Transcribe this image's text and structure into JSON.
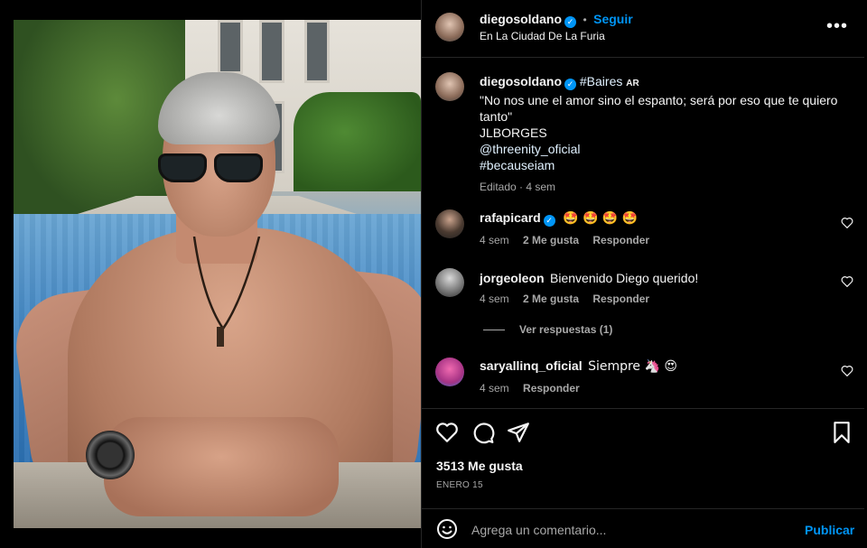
{
  "post": {
    "author": "diegosoldano",
    "follow_label": "Seguir",
    "location": "En La Ciudad De La Furia",
    "more_icon": "more-horizontal-icon"
  },
  "caption": {
    "author": "diegosoldano",
    "tag_inline": "#Baires",
    "country": "AR",
    "lines": [
      "\"No nos une el amor sino el espanto; será por eso que te quiero",
      "tanto\"",
      "JLBORGES",
      "@threenity_oficial",
      "#becauseiam"
    ],
    "meta": "Editado · 4 sem"
  },
  "comments": [
    {
      "user": "rafapicard",
      "verified": true,
      "text": "🤩 🤩 🤩 🤩",
      "time": "4 sem",
      "likes": "2 Me gusta",
      "reply": "Responder"
    },
    {
      "user": "jorgeoleon",
      "verified": false,
      "text": "Bienvenido Diego querido!",
      "time": "4 sem",
      "likes": "2 Me gusta",
      "reply": "Responder"
    },
    {
      "user": "saryallinq_oficial",
      "verified": false,
      "text": "Siempre 🦄 😍",
      "time": "4 sem",
      "likes": "",
      "reply": "Responder"
    }
  ],
  "view_replies": "Ver respuestas (1)",
  "actions": {
    "likes": "3513 Me gusta",
    "date": "ENERO 15",
    "comment_placeholder": "Agrega un comentario...",
    "publish": "Publicar"
  },
  "colors": {
    "accent": "#0095f6",
    "background": "#000000",
    "divider": "#262626",
    "muted": "#a8a8a8"
  }
}
